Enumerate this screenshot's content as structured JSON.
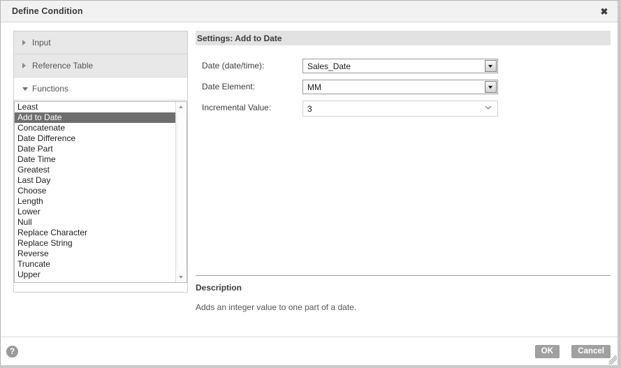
{
  "window": {
    "title": "Define Condition",
    "close_label": "✖"
  },
  "left_panel": {
    "sections": [
      {
        "label": "Input",
        "expanded": false
      },
      {
        "label": "Reference Table",
        "expanded": false
      },
      {
        "label": "Functions",
        "expanded": true
      }
    ],
    "functions": {
      "items": [
        "Least",
        "Add to Date",
        "Concatenate",
        "Date Difference",
        "Date Part",
        "Date Time",
        "Greatest",
        "Last Day",
        "Choose",
        "Length",
        "Lower",
        "Null",
        "Replace Character",
        "Replace String",
        "Reverse",
        "Truncate",
        "Upper"
      ],
      "selected": "Add to Date",
      "selected_index": 1
    }
  },
  "settings": {
    "header": "Settings: Add to Date",
    "fields": [
      {
        "label": "Date (date/time):",
        "value": "Sales_Date",
        "control": "combo"
      },
      {
        "label": "Date Element:",
        "value": "MM",
        "control": "combo"
      },
      {
        "label": "Incremental Value:",
        "value": "3",
        "control": "spinner"
      }
    ]
  },
  "description": {
    "title": "Description",
    "text": "Adds an integer value to one part of a date."
  },
  "footer": {
    "help_glyph": "?",
    "ok_label": "OK",
    "cancel_label": "Cancel"
  },
  "colors": {
    "selection": "#6e6e6e",
    "header_band": "#e2e2e2",
    "button": "#a0a0a0",
    "titlebar": "#f2f2f2"
  }
}
